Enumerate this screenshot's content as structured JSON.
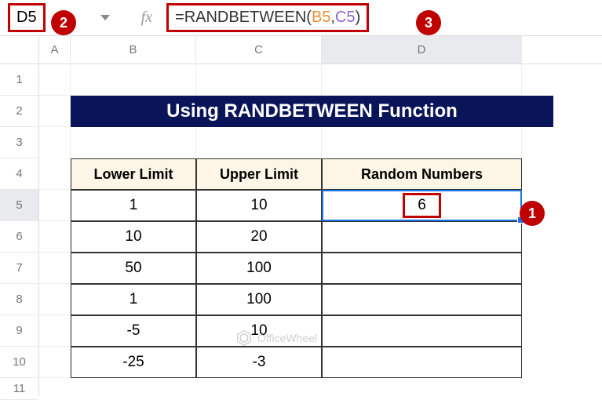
{
  "nameBox": "D5",
  "formula": {
    "eq": "=",
    "fn": "RANDBETWEEN",
    "open": "(",
    "ref1": "B5",
    "comma": ",",
    "ref2": "C5",
    "close": ")"
  },
  "callouts": {
    "c1": "1",
    "c2": "2",
    "c3": "3"
  },
  "cols": {
    "A": "A",
    "B": "B",
    "C": "C",
    "D": "D"
  },
  "rows": [
    "1",
    "2",
    "3",
    "4",
    "5",
    "6",
    "7",
    "8",
    "9",
    "10",
    "11"
  ],
  "title": "Using RANDBETWEEN Function",
  "headers": {
    "lower": "Lower Limit",
    "upper": "Upper Limit",
    "random": "Random Numbers"
  },
  "data": [
    {
      "lower": "1",
      "upper": "10",
      "random": "6"
    },
    {
      "lower": "10",
      "upper": "20",
      "random": ""
    },
    {
      "lower": "50",
      "upper": "100",
      "random": ""
    },
    {
      "lower": "1",
      "upper": "100",
      "random": ""
    },
    {
      "lower": "-5",
      "upper": "10",
      "random": ""
    },
    {
      "lower": "-25",
      "upper": "-3",
      "random": ""
    }
  ],
  "watermark": "OfficeWheel",
  "fx": "fx"
}
